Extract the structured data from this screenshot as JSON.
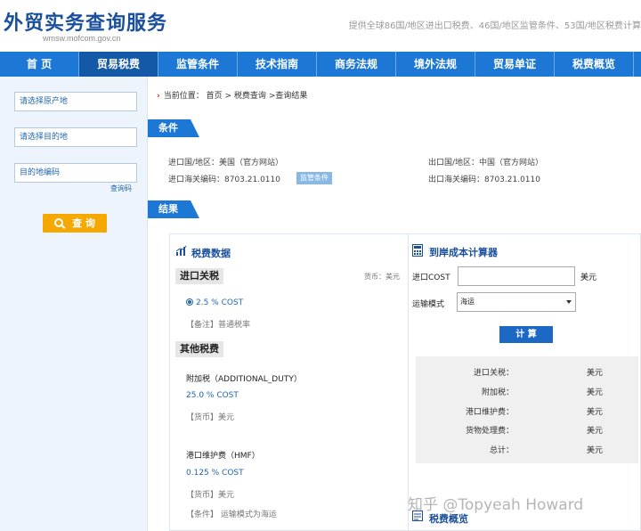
{
  "header": {
    "title": "外贸实务查询服务",
    "subtitle": "wmsw.mofcom.gov.cn",
    "tagline": "提供全球86国/地区进出口税费、46国/地区监管条件、53国/地区税费计算"
  },
  "nav": {
    "items": [
      {
        "label": "首 页"
      },
      {
        "label": "贸易税费"
      },
      {
        "label": "监管条件"
      },
      {
        "label": "技术指南"
      },
      {
        "label": "商务法规"
      },
      {
        "label": "境外法规"
      },
      {
        "label": "贸易单证"
      },
      {
        "label": "税费概览"
      }
    ]
  },
  "sidebar": {
    "origin_placeholder": "请选择原产地",
    "destination_placeholder": "请选择目的地",
    "code_placeholder": "目的地编码",
    "code_link": "查询码",
    "search_label": "查 询"
  },
  "breadcrumb": {
    "prefix": "当前位置：",
    "home": "首页",
    "sep1": ">",
    "level1": "税费查询",
    "sep2": ">",
    "level2": "查询结果"
  },
  "conditions": {
    "tab_label": "条件",
    "import_country": "进口国/地区：美国（官方网站）",
    "import_code": "进口海关编码：8703.21.0110",
    "badge": "监管条件",
    "export_country": "出口国/地区：中国（官方网站）",
    "export_code": "出口海关编码：8703.21.0110"
  },
  "results": {
    "tab_label": "结果",
    "tax_data_title": "税费数据",
    "import_duty_tag": "进口关税",
    "currency_note": "货币：美元",
    "import_rate": "2.5 % COST",
    "import_remark": "【备注】普通税率",
    "other_tag": "其他税费",
    "additional_duty_name": "附加税（ADDITIONAL_DUTY）",
    "additional_duty_rate": "25.0 % COST",
    "additional_duty_currency": "【货币】美元",
    "hmf_name": "港口维护费（HMF）",
    "hmf_rate": "0.125 % COST",
    "hmf_currency": "【货币】美元",
    "hmf_condition": "【条件】 运输模式为海运"
  },
  "calculator": {
    "title": "到岸成本计算器",
    "cost_label": "进口COST",
    "cost_value": "",
    "cost_unit": "美元",
    "transport_label": "运输模式",
    "transport_selected": "海运",
    "calc_button": "计 算",
    "rows": [
      {
        "label": "进口关税：",
        "unit": "美元"
      },
      {
        "label": "附加税：",
        "unit": "美元"
      },
      {
        "label": "港口维护费：",
        "unit": "美元"
      },
      {
        "label": "货物处理费：",
        "unit": "美元"
      },
      {
        "label": "总计：",
        "unit": "美元"
      }
    ]
  },
  "overview": {
    "title": "税费概览"
  },
  "watermark": "知乎 @Topyeah Howard"
}
